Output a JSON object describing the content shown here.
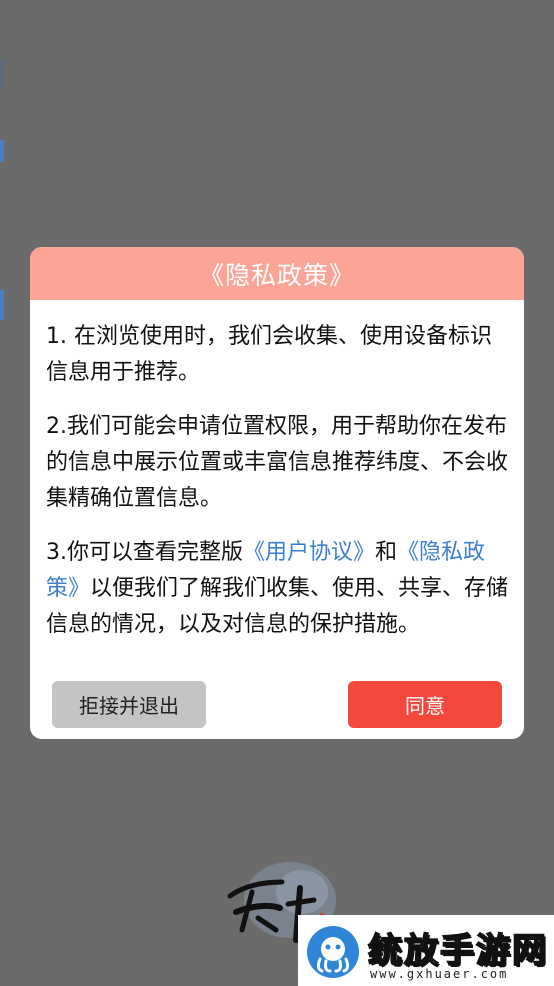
{
  "dialog": {
    "title": "《隐私政策》",
    "paragraphs": {
      "p1": "1. 在浏览使用时，我们会收集、使用设备标识信息用于推荐。",
      "p2": "2.我们可能会申请位置权限，用于帮助你在发布的信息中展示位置或丰富信息推荐纬度、不会收集精确位置信息。",
      "p3": {
        "prefix": "3.你可以查看完整版",
        "link_user_agreement": "《用户协议》",
        "and": "和",
        "link_privacy_policy": "《隐私政策》",
        "suffix": "以便我们了解我们收集、使用、共享、存储信息的情况，以及对信息的保护措施。"
      }
    },
    "buttons": {
      "reject": "拒接并退出",
      "agree": "同意"
    }
  },
  "watermark": {
    "title": "统放手游网",
    "url": "www.gxhuaer.com"
  },
  "colors": {
    "overlay": "#6b6b6b",
    "header": "#fca597",
    "link": "#3b7fd2",
    "agree_button": "#f5483d",
    "reject_button": "#c4c4c4"
  }
}
